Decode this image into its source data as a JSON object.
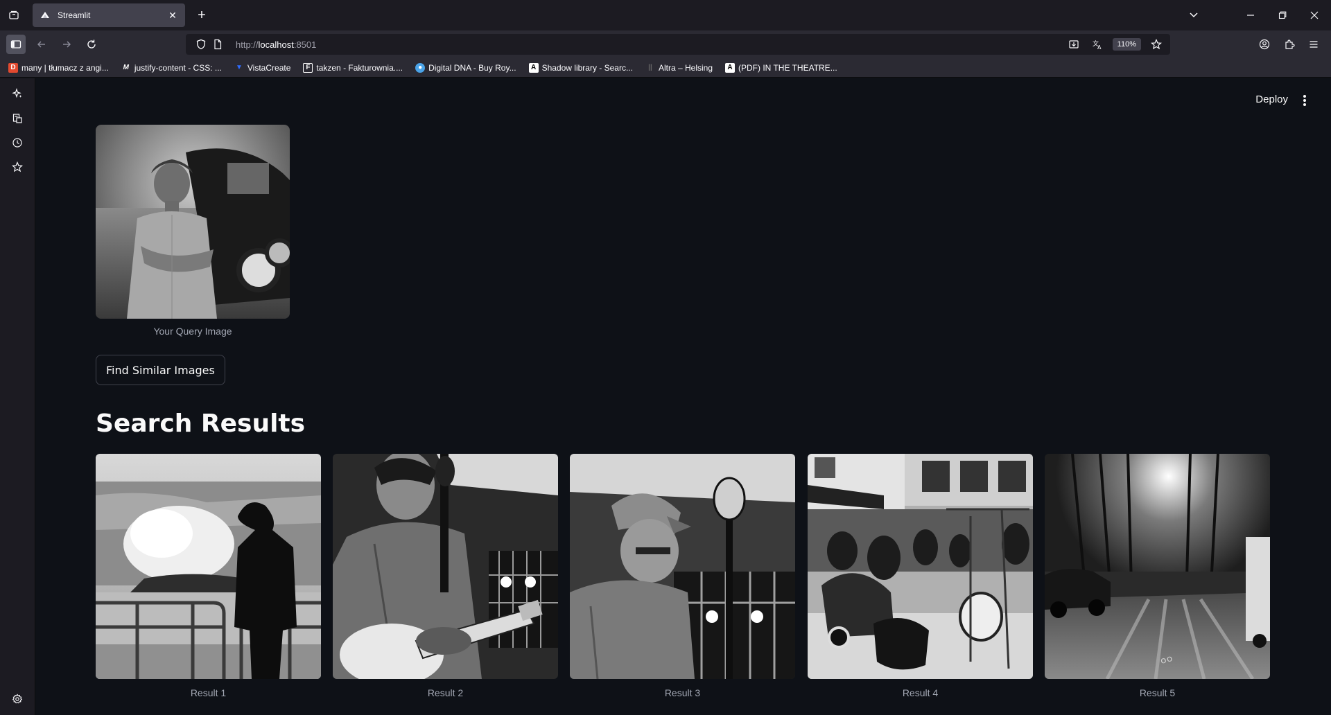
{
  "browser": {
    "tab_title": "Streamlit",
    "url_protocol": "http://",
    "url_host": "localhost",
    "url_port": ":8501",
    "zoom": "110%"
  },
  "bookmarks": [
    {
      "label": "many | tłumacz z angi...",
      "icon": "dictionary-icon",
      "color": "#e2492f"
    },
    {
      "label": "justify-content - CSS: ...",
      "icon": "mdn-icon",
      "color": "#ffffff"
    },
    {
      "label": "VistaCreate",
      "icon": "vistacreate-icon",
      "color": "#2e6cff"
    },
    {
      "label": "takzen - Fakturownia....",
      "icon": "fakturownia-icon",
      "color": "#ffffff"
    },
    {
      "label": "Digital DNA - Buy Roy...",
      "icon": "digitaldna-icon",
      "color": "#4aa3e8"
    },
    {
      "label": "Shadow library - Searc...",
      "icon": "annas-archive-icon",
      "color": "#ffffff"
    },
    {
      "label": "Altra – Helsing",
      "icon": "altra-icon",
      "color": "#555555"
    },
    {
      "label": "(PDF) IN THE THEATRE...",
      "icon": "academia-icon",
      "color": "#ffffff"
    }
  ],
  "app": {
    "deploy_label": "Deploy",
    "query_caption": "Your Query Image",
    "find_button": "Find Similar Images",
    "results_title": "Search Results",
    "results": [
      {
        "caption": "Result 1"
      },
      {
        "caption": "Result 2"
      },
      {
        "caption": "Result 3"
      },
      {
        "caption": "Result 4"
      },
      {
        "caption": "Result 5"
      }
    ]
  }
}
